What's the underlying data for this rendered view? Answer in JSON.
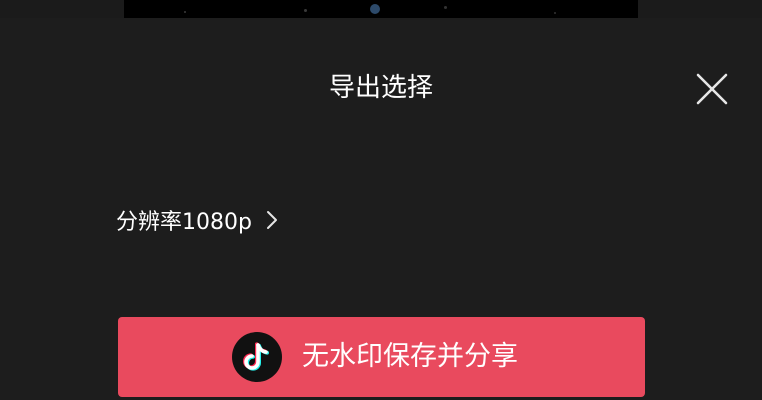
{
  "dialog": {
    "title": "导出选择",
    "close_icon": "close-icon"
  },
  "resolution": {
    "label": "分辨率1080p",
    "chevron_icon": "chevron-right-icon"
  },
  "export_button": {
    "label": "无水印保存并分享",
    "icon": "tiktok-logo-icon",
    "color": "#e94a5e"
  },
  "colors": {
    "background": "#1d1d1d",
    "text": "#ffffff"
  }
}
